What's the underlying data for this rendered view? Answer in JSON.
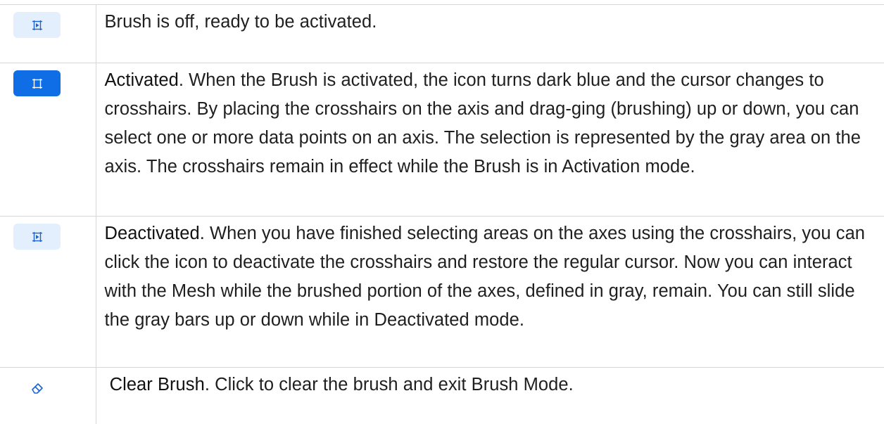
{
  "colors": {
    "icon_light_bg": "#e4effd",
    "icon_active_bg": "#0f6ee6",
    "icon_blue": "#1b64d2",
    "border": "#d6d6d6"
  },
  "rows": [
    {
      "icon": "brush-off-icon",
      "term": "",
      "text": "Brush is off, ready to be activated."
    },
    {
      "icon": "brush-activated-icon",
      "term": "Activated",
      "text": ". When the Brush is activated, the icon turns dark blue and the cursor changes to crosshairs. By placing the crosshairs on the axis and drag-ging (brushing) up or down, you can select one or more data points on an axis. The selection is represented by the gray area on the axis. The crosshairs remain in effect while the Brush is in Activation mode."
    },
    {
      "icon": "brush-deactivated-icon",
      "term": "Deactivated",
      "text": ". When you have finished selecting areas on the axes using the crosshairs, you can click the icon to deactivate the crosshairs and restore the regular cursor. Now you can interact with the Mesh while the brushed portion of the axes, defined in gray, remain. You can still slide the gray bars up or down while in Deactivated mode."
    },
    {
      "icon": "eraser-icon",
      "term": "Clear Brush",
      "text": ". Click to clear the brush and exit Brush Mode."
    }
  ]
}
